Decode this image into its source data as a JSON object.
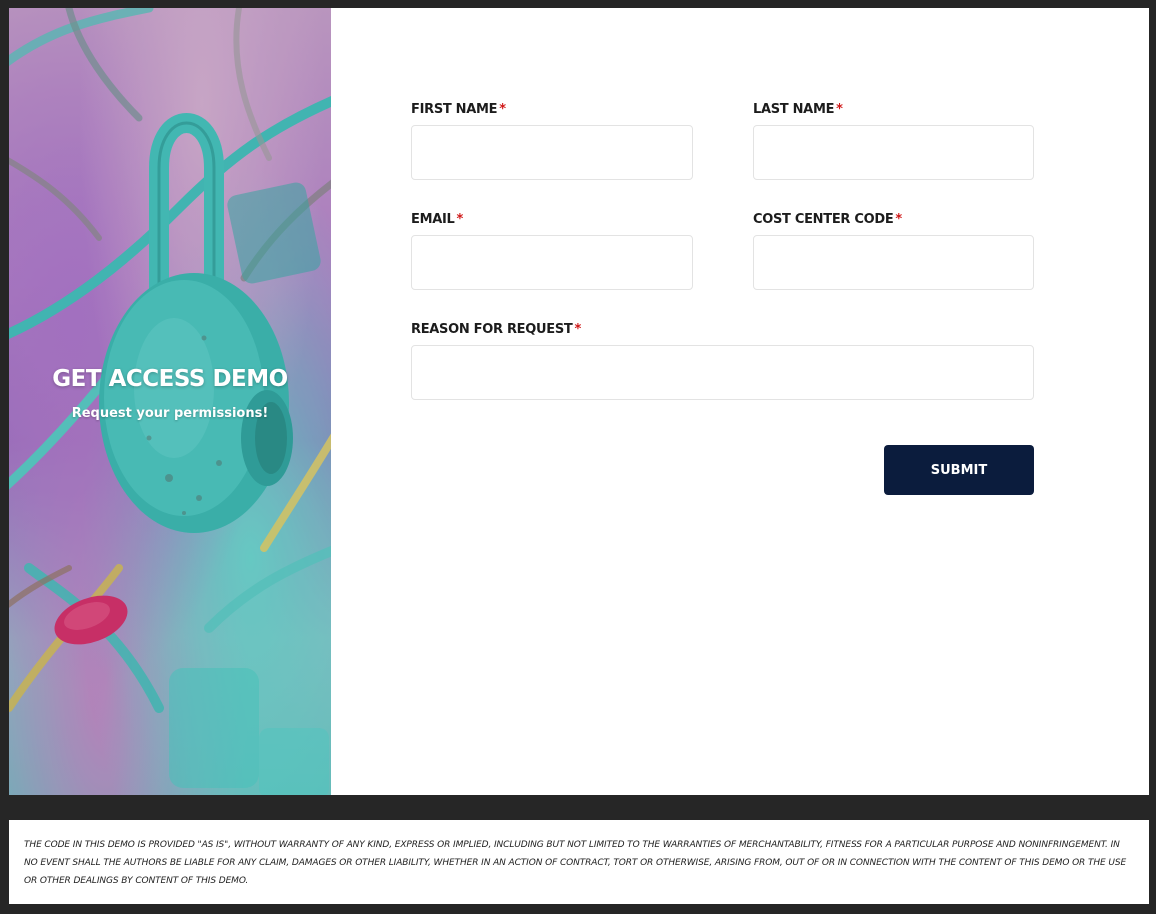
{
  "hero": {
    "title": "GET ACCESS DEMO",
    "subtitle": "Request your permissions!"
  },
  "form": {
    "required_marker": "*",
    "first_name": {
      "label": "FIRST NAME",
      "value": ""
    },
    "last_name": {
      "label": "LAST NAME",
      "value": ""
    },
    "email": {
      "label": "EMAIL",
      "value": ""
    },
    "cost_center_code": {
      "label": "COST CENTER CODE",
      "value": ""
    },
    "reason_for_request": {
      "label": "REASON FOR REQUEST",
      "value": ""
    },
    "submit_label": "SUBMIT"
  },
  "footer": {
    "disclaimer": "THE CODE IN THIS DEMO IS PROVIDED \"AS IS\", WITHOUT WARRANTY OF ANY KIND, EXPRESS OR IMPLIED, INCLUDING BUT NOT LIMITED TO THE WARRANTIES OF MERCHANTABILITY, FITNESS FOR A PARTICULAR PURPOSE AND NONINFRINGEMENT. IN NO EVENT SHALL THE AUTHORS BE LIABLE FOR ANY CLAIM, DAMAGES OR OTHER LIABILITY, WHETHER IN AN ACTION OF CONTRACT, TORT OR OTHERWISE, ARISING FROM, OUT OF OR IN CONNECTION WITH THE CONTENT OF THIS DEMO OR THE USE OR OTHER DEALINGS BY CONTENT OF THIS DEMO."
  },
  "colors": {
    "submit_bg": "#0b1c3d",
    "required_marker": "#d01818",
    "page_bg": "#262626"
  }
}
